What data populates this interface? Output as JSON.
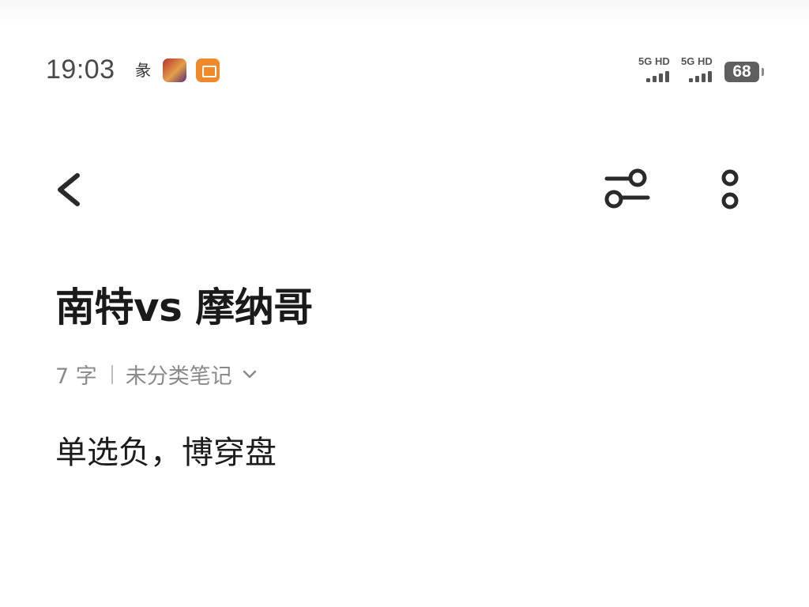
{
  "status_bar": {
    "time": "19:03",
    "notification_icons": [
      "calligraphy-app-icon",
      "game-app-icon",
      "shopping-app-icon"
    ],
    "sim1": {
      "label": "5G HD",
      "bars": 4
    },
    "sim2": {
      "label": "5G HD",
      "bars": 4
    },
    "battery_level": "68"
  },
  "toolbar": {
    "back_icon": "chevron-left-icon",
    "filter_icon": "sliders-icon",
    "more_icon": "more-vertical-icon"
  },
  "note": {
    "title": "南特vs 摩纳哥",
    "word_count": "7 字",
    "category": "未分类笔记",
    "body": "单选负，博穿盘"
  },
  "colors": {
    "background": "#ffffff",
    "text_primary": "#1a1a1a",
    "text_secondary": "#8a8a8a",
    "icon": "#2a2a2a"
  }
}
